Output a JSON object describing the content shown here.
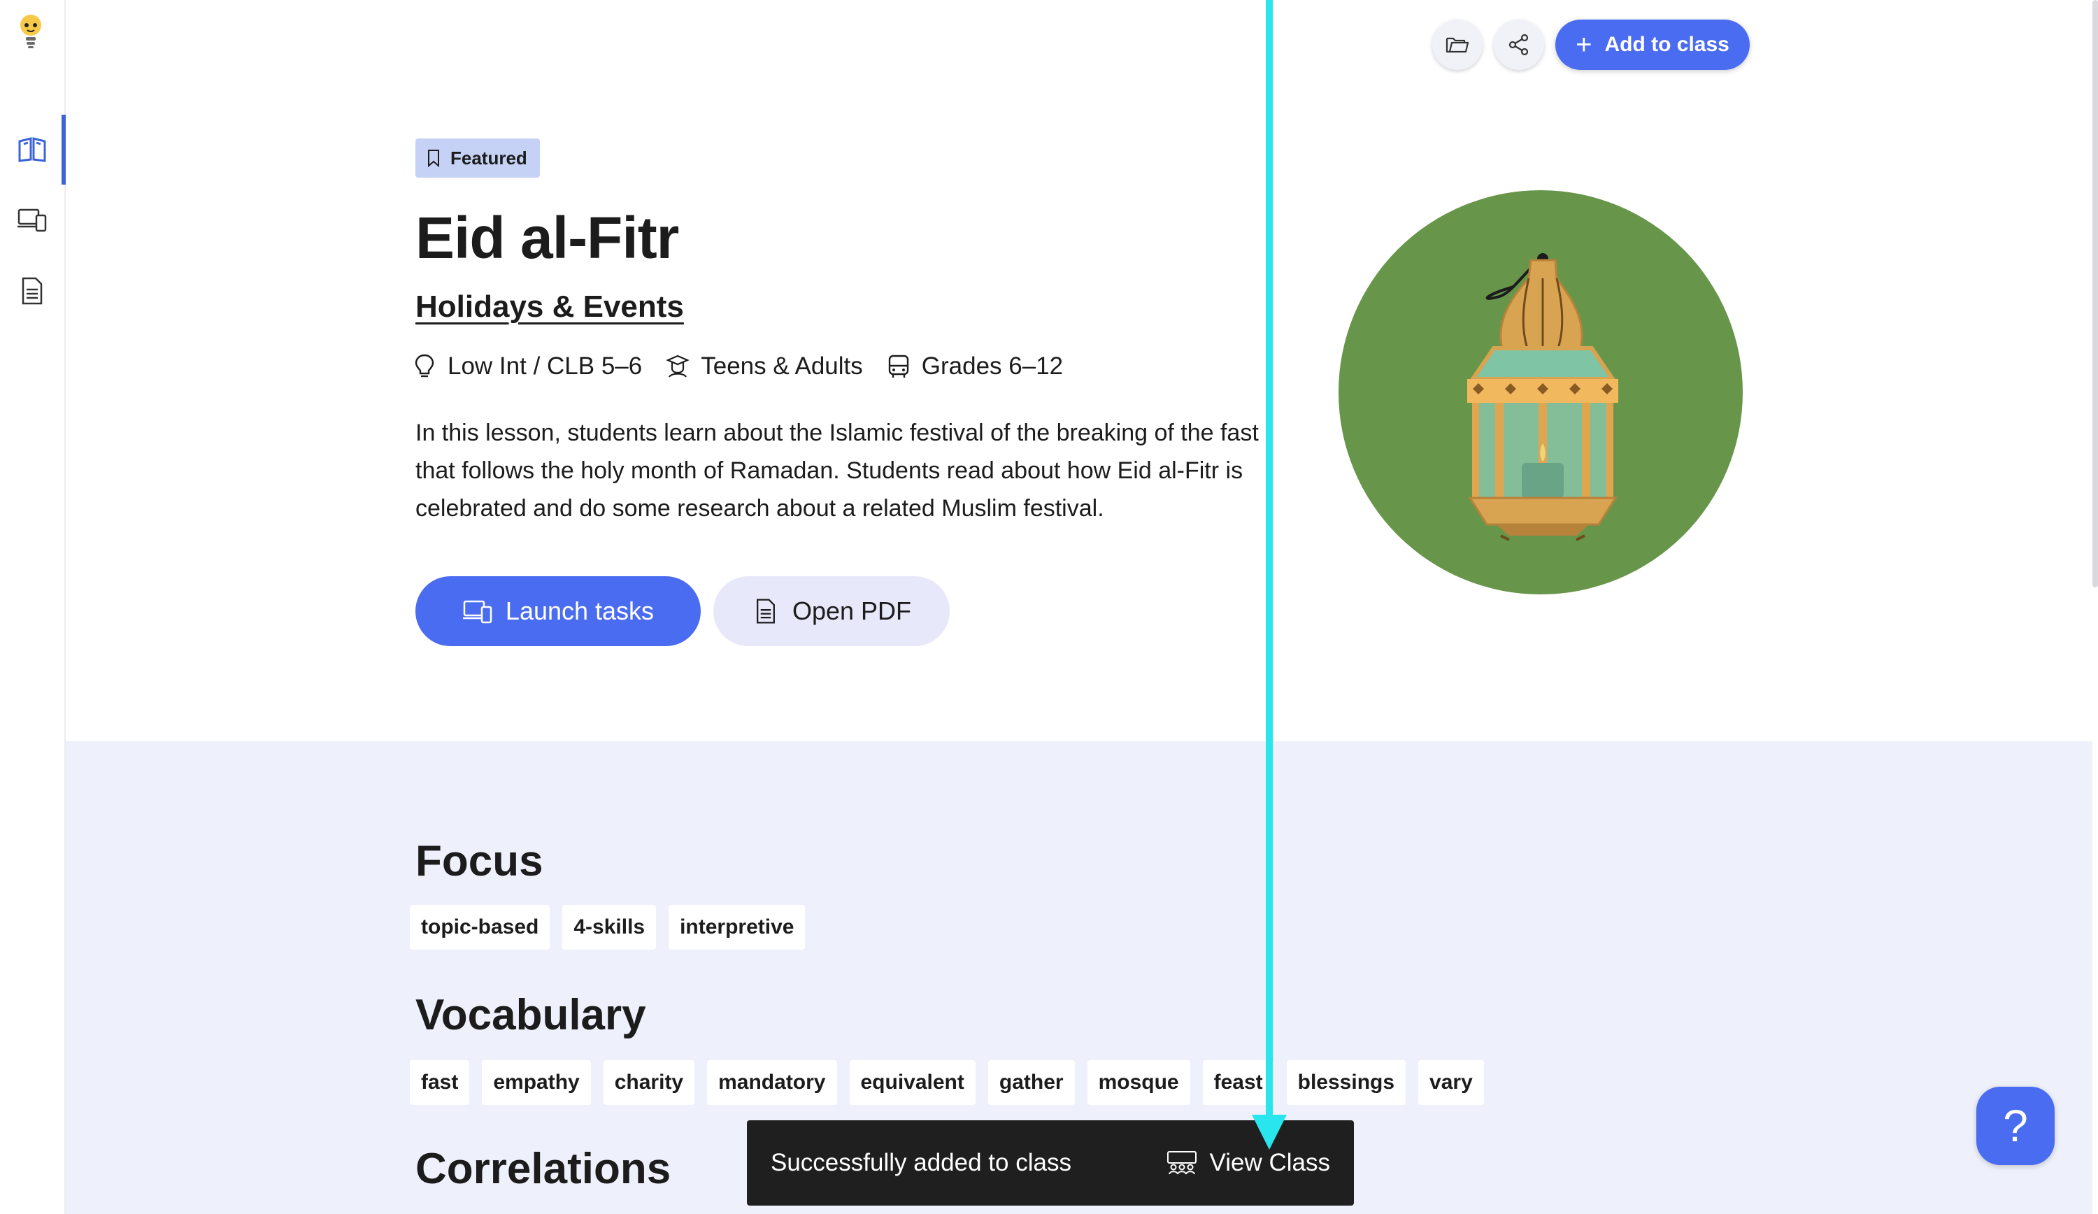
{
  "header": {
    "add_to_class_label": "Add to class"
  },
  "lesson": {
    "badge": "Featured",
    "title": "Eid al-Fitr",
    "category": "Holidays & Events",
    "level": "Low Int / CLB 5–6",
    "audience": "Teens & Adults",
    "grades": "Grades 6–12",
    "description": "In this lesson, students learn about the Islamic festival of the breaking of the fast that follows the holy month of Ramadan. Students read about how Eid al-Fitr is celebrated and do some research about a related Muslim festival.",
    "launch_label": "Launch tasks",
    "pdf_label": "Open PDF"
  },
  "focus": {
    "title": "Focus",
    "tags": [
      "topic-based",
      "4-skills",
      "interpretive"
    ]
  },
  "vocabulary": {
    "title": "Vocabulary",
    "tags": [
      "fast",
      "empathy",
      "charity",
      "mandatory",
      "equivalent",
      "gather",
      "mosque",
      "feast",
      "blessings",
      "vary"
    ]
  },
  "correlations": {
    "title": "Correlations"
  },
  "toast": {
    "message": "Successfully added to class",
    "action_label": "View Class"
  },
  "help": {
    "label": "?"
  },
  "colors": {
    "accent": "#4a6cf0",
    "featured_bg": "#c5d2f6",
    "lower_bg": "#eef1fb",
    "illustration_bg": "#67964a",
    "toast_bg": "#1f1f1f",
    "annotation": "#29e6ee"
  },
  "icons": {
    "logo": "lightbulb-logo-icon",
    "sidebar": [
      "book-open-icon",
      "devices-icon",
      "document-icon"
    ],
    "folder": "folder-icon",
    "share": "share-icon"
  }
}
